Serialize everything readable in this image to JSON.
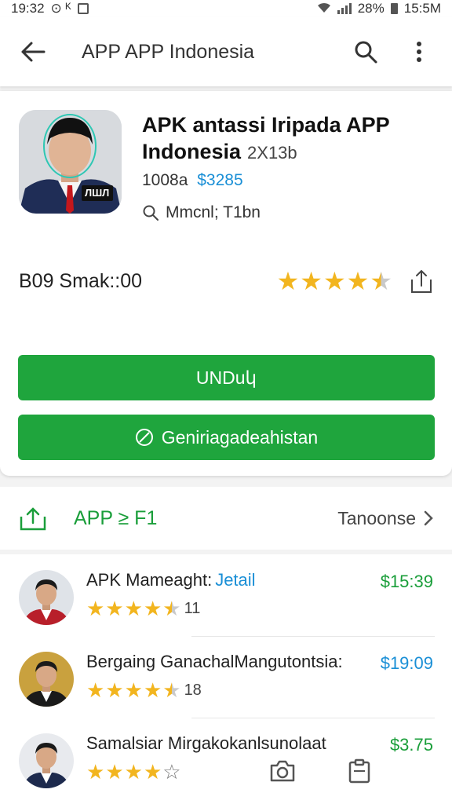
{
  "status_bar": {
    "time": "19:32",
    "left_glyphs": "⊙ ᴷ",
    "battery_pct": "28%",
    "right_time": "15:5M"
  },
  "app_bar": {
    "title": "APP APP Indonesia",
    "back_icon": "arrow-left-icon",
    "search_icon": "search-icon",
    "menu_icon": "more-vert-icon"
  },
  "app": {
    "name": "APK antassi Iripada APP Indonesia",
    "size": "2X13b",
    "downloads": "1008a",
    "price": "$3285",
    "developer": "Mmcnl; T1bn",
    "icon_badge": "ЛШЛ",
    "rating_label": "B09 Smak::00",
    "rating": 4.5,
    "install_label": "UNDuկ",
    "secondary_label": "Geniriagadeahistan"
  },
  "section": {
    "label": "APP ≥ F1",
    "more_label": "Tanoonse"
  },
  "list": [
    {
      "name": "APK Mameaght:",
      "link": "Jetail",
      "price": "$15:39",
      "price_color": "green",
      "rating": 4.5,
      "count": "11",
      "suit": "red"
    },
    {
      "name": "Bergaing GanachalMangutontsia:",
      "link": "",
      "price": "$19:09",
      "price_color": "blue",
      "rating": 4.5,
      "count": "18",
      "suit": "dark"
    },
    {
      "name": "Samalsiar Mirgakokanlsunolaat",
      "link": "",
      "price": "$3.75",
      "price_color": "green",
      "rating": 4,
      "count": "",
      "suit": "navy"
    }
  ],
  "colors": {
    "accent_green": "#1fa53d",
    "link_blue": "#1a8fd6",
    "star_gold": "#f2b51f"
  }
}
